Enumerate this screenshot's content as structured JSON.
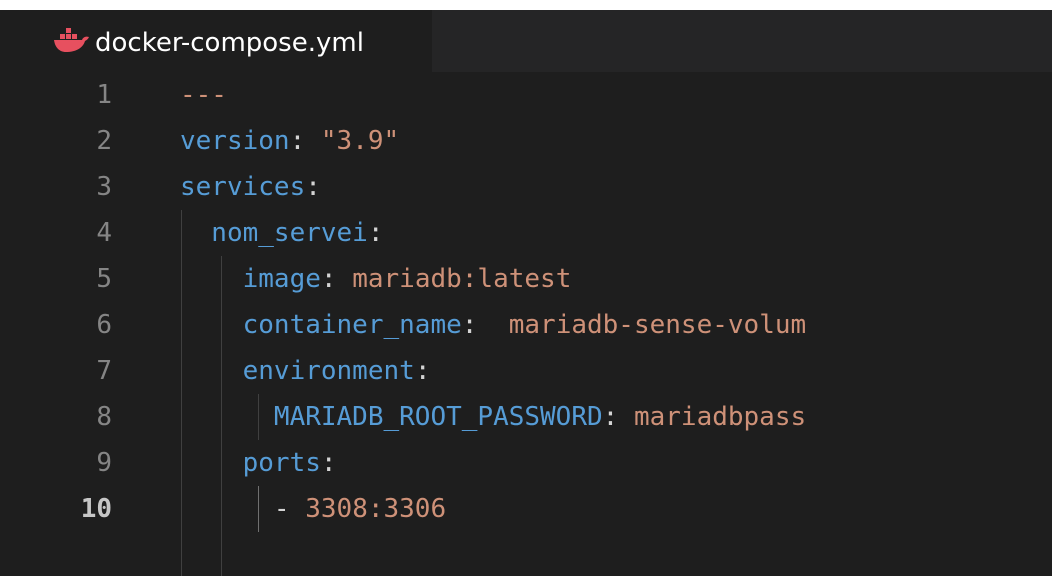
{
  "tab": {
    "filename": "docker-compose.yml",
    "icon": "docker-whale-icon"
  },
  "lines": [
    {
      "num": "1",
      "parts": [
        {
          "t": "---",
          "c": "str"
        }
      ]
    },
    {
      "num": "2",
      "parts": [
        {
          "t": "version",
          "c": "key"
        },
        {
          "t": ": ",
          "c": "punc"
        },
        {
          "t": "\"3.9\"",
          "c": "str"
        }
      ]
    },
    {
      "num": "3",
      "parts": [
        {
          "t": "services",
          "c": "key"
        },
        {
          "t": ":",
          "c": "punc"
        }
      ]
    },
    {
      "num": "4",
      "parts": [
        {
          "t": "  nom_servei",
          "c": "key"
        },
        {
          "t": ":",
          "c": "punc"
        }
      ]
    },
    {
      "num": "5",
      "parts": [
        {
          "t": "    image",
          "c": "key"
        },
        {
          "t": ": ",
          "c": "punc"
        },
        {
          "t": "mariadb:latest",
          "c": "str"
        }
      ]
    },
    {
      "num": "6",
      "parts": [
        {
          "t": "    container_name",
          "c": "key"
        },
        {
          "t": ":  ",
          "c": "punc"
        },
        {
          "t": "mariadb-sense-volum",
          "c": "str"
        }
      ]
    },
    {
      "num": "7",
      "parts": [
        {
          "t": "    environment",
          "c": "key"
        },
        {
          "t": ":",
          "c": "punc"
        }
      ]
    },
    {
      "num": "8",
      "parts": [
        {
          "t": "      MARIADB_ROOT_PASSWORD",
          "c": "key"
        },
        {
          "t": ": ",
          "c": "punc"
        },
        {
          "t": "mariadbpass",
          "c": "str"
        }
      ]
    },
    {
      "num": "9",
      "parts": [
        {
          "t": "    ports",
          "c": "key"
        },
        {
          "t": ":",
          "c": "punc"
        }
      ]
    },
    {
      "num": "10",
      "parts": [
        {
          "t": "      - ",
          "c": "punc"
        },
        {
          "t": "3308:3306",
          "c": "str"
        }
      ],
      "active": true
    }
  ],
  "colors": {
    "background": "#1e1e1e",
    "key": "#569cd6",
    "string": "#ce9178",
    "line_number": "#858585",
    "docker_icon": "#e7505f"
  }
}
